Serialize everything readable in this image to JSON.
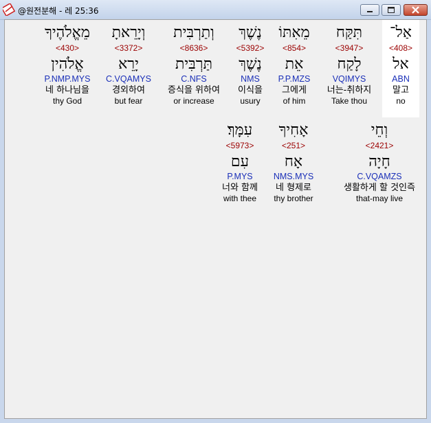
{
  "window": {
    "title": "@원전분해 - 레 25:36",
    "icon": "bible-book-icon",
    "title_color": "#000000"
  },
  "colors": {
    "strong": "#9b0000",
    "morph": "#1a2fb8",
    "text": "#000000",
    "background": "#f0f0f0"
  },
  "verse_rows": [
    {
      "words": [
        {
          "hebrew": "אַל־",
          "strong": "<408>",
          "lemma": "אל",
          "morph": "ABN",
          "korean": "말고",
          "english": "no",
          "highlighted": true
        },
        {
          "hebrew": "תִּקַּח",
          "strong": "<3947>",
          "lemma": "לָקַח",
          "morph": "VQIMYS",
          "korean": "너는-취하지",
          "english": "Take thou",
          "highlighted": false
        },
        {
          "hebrew": "מֵאִתּוֹ",
          "strong": "<854>",
          "lemma": "אֵת",
          "morph": "P.P.MZS",
          "korean": "그에게",
          "english": "of him",
          "highlighted": false
        },
        {
          "hebrew": "נֶשֶׁךְ",
          "strong": "<5392>",
          "lemma": "נֶשֶׁךְ",
          "morph": "NMS",
          "korean": "이식을",
          "english": "usury",
          "highlighted": false
        },
        {
          "hebrew": "וְתַרְבִּית",
          "strong": "<8636>",
          "lemma": "תַּרְבִּית",
          "morph": "C.NFS",
          "korean": "증식을 위하여",
          "english": "or increase",
          "highlighted": false
        },
        {
          "hebrew": "וְיָרֵאתָ",
          "strong": "<3372>",
          "lemma": "יָרֵא",
          "morph": "C.VQAMYS",
          "korean": "경외하여",
          "english": "but fear",
          "highlighted": false
        },
        {
          "hebrew": "מֵאֱלֹהֶיךָ",
          "strong": "<430>",
          "lemma": "אֱלֹהִין",
          "morph": "P.NMP.MYS",
          "korean": "네 하나님을",
          "english": "thy God",
          "highlighted": false
        }
      ]
    },
    {
      "words": [
        {
          "hebrew": "וְחֵי",
          "strong": "<2421>",
          "lemma": "חָיָה",
          "morph": "C.VQAMZS",
          "korean": "생활하게 할 것인즉",
          "english": "that-may live",
          "highlighted": false
        },
        {
          "hebrew": "אָחִיךָ",
          "strong": "<251>",
          "lemma": "אָח",
          "morph": "NMS.MYS",
          "korean": "네 형제로",
          "english": "thy brother",
          "highlighted": false
        },
        {
          "hebrew": "עִמָּךְ׃",
          "strong": "<5973>",
          "lemma": "עִם",
          "morph": "P.MYS",
          "korean": "너와 함께",
          "english": "with thee",
          "highlighted": false
        }
      ]
    }
  ]
}
